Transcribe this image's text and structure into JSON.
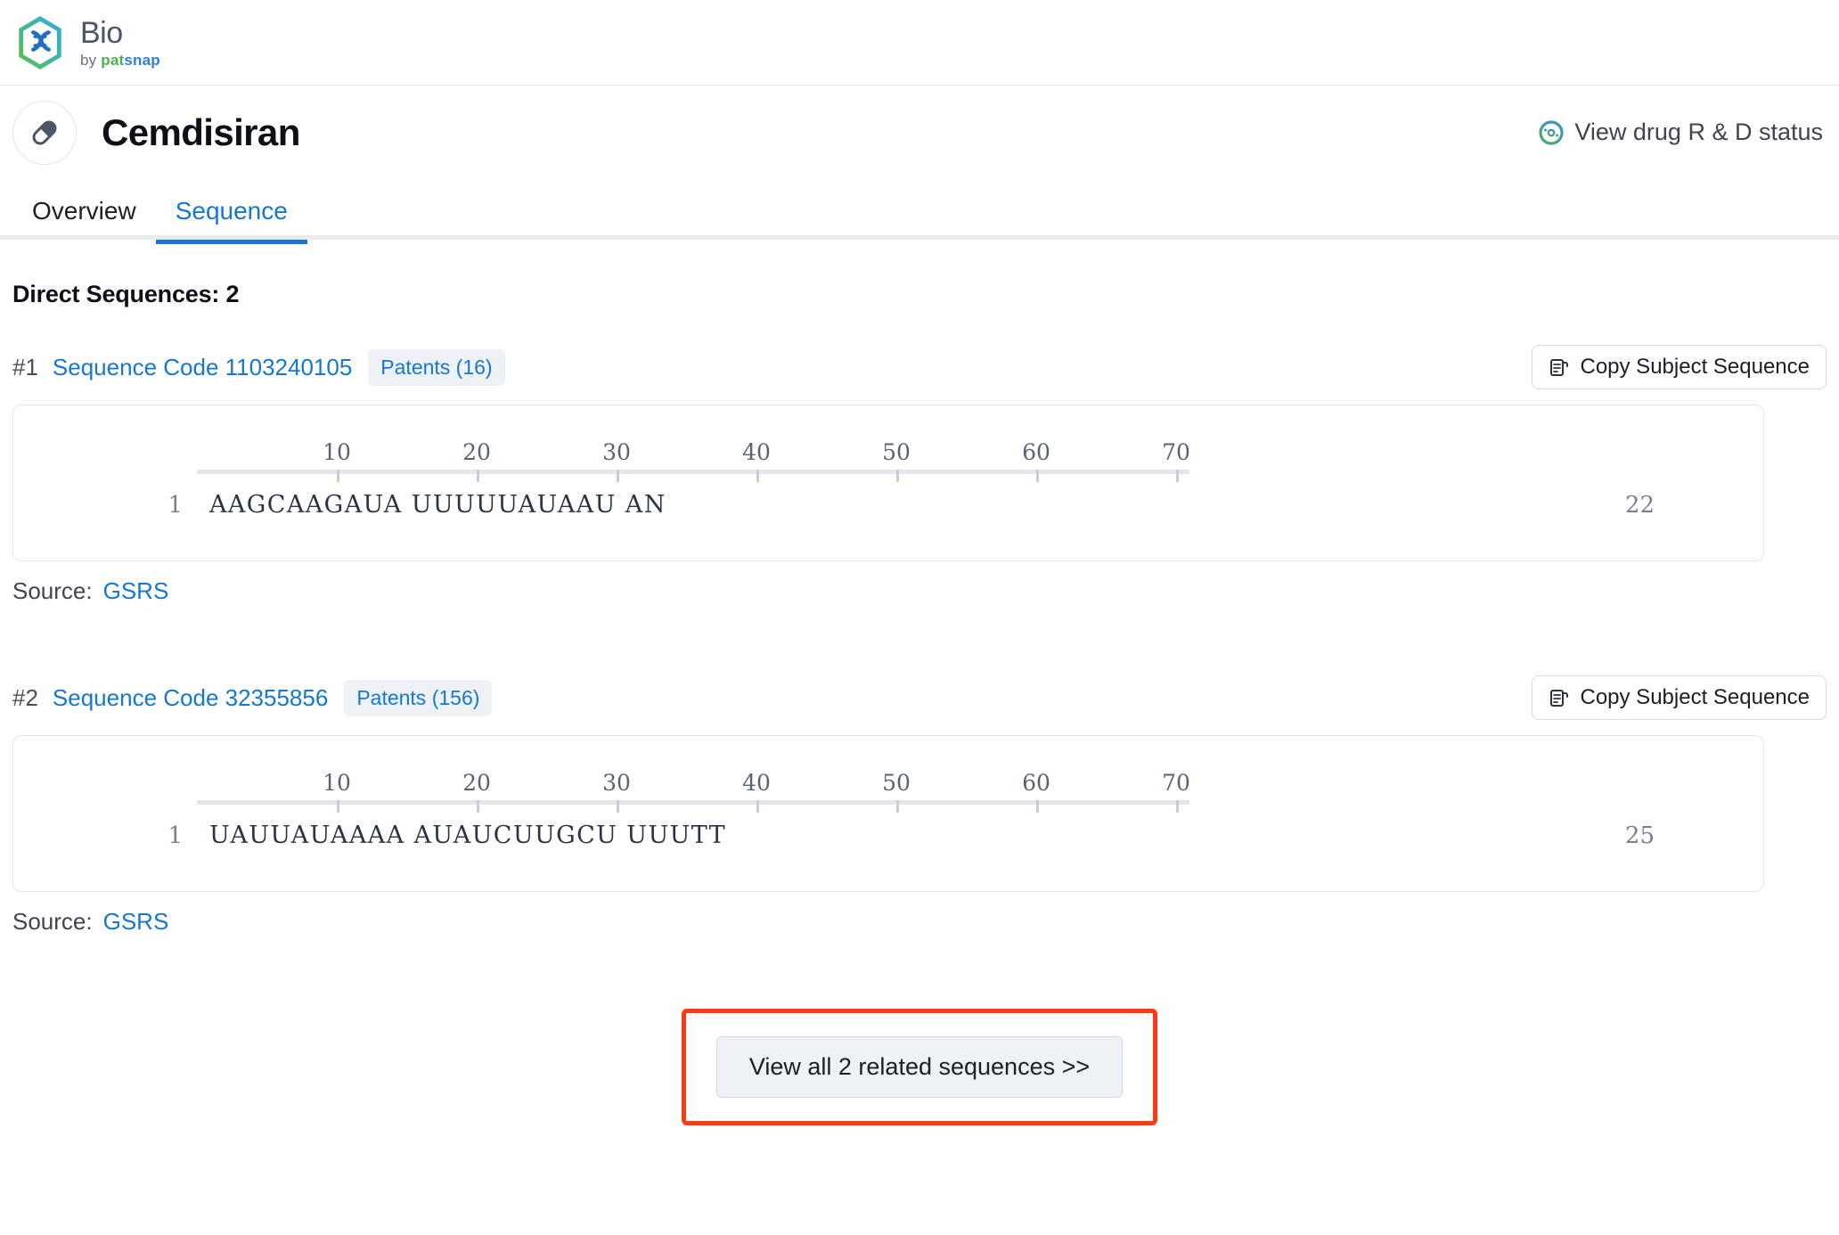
{
  "brand": {
    "logo_icon": "dna-hexagon-logo",
    "title": "Bio",
    "by": "by ",
    "pat": "pat",
    "snap": "snap"
  },
  "drug_header": {
    "icon": "capsule-icon",
    "name": "Cemdisiran",
    "rd_status_icon": "rd-status-icon",
    "rd_status_label": "View drug R & D status"
  },
  "tabs": [
    {
      "label": "Overview",
      "active": false
    },
    {
      "label": "Sequence",
      "active": true
    }
  ],
  "main": {
    "section_title": "Direct Sequences: 2",
    "ruler_ticks": [
      "10",
      "20",
      "30",
      "40",
      "50",
      "60",
      "70"
    ],
    "copy_button_label": "Copy Subject Sequence",
    "source_label": "Source:",
    "source_value": "GSRS",
    "sequences": [
      {
        "index": "#1",
        "code": "Sequence Code 1103240105",
        "patents": "Patents (16)",
        "copy_label": "Copy Subject Sequence",
        "start": "1",
        "bases": "AAGCAAGAUA UUUUUAUAAU AN",
        "end": "22",
        "source_label": "Source:",
        "source_value": "GSRS"
      },
      {
        "index": "#2",
        "code": "Sequence Code 32355856",
        "patents": "Patents (156)",
        "copy_label": "Copy Subject Sequence",
        "start": "1",
        "bases": "UAUUAUAAAA AUAUCUUGCU UUUTT",
        "end": "25",
        "source_label": "Source:",
        "source_value": "GSRS"
      }
    ]
  },
  "footer": {
    "view_all_label": "View all 2 related sequences >>",
    "highlight_color": "#fc3a14"
  },
  "colors": {
    "link": "#1677d2",
    "accent": "#1677d2",
    "chip_bg": "#eef1f5",
    "border": "#e4e6eb"
  }
}
